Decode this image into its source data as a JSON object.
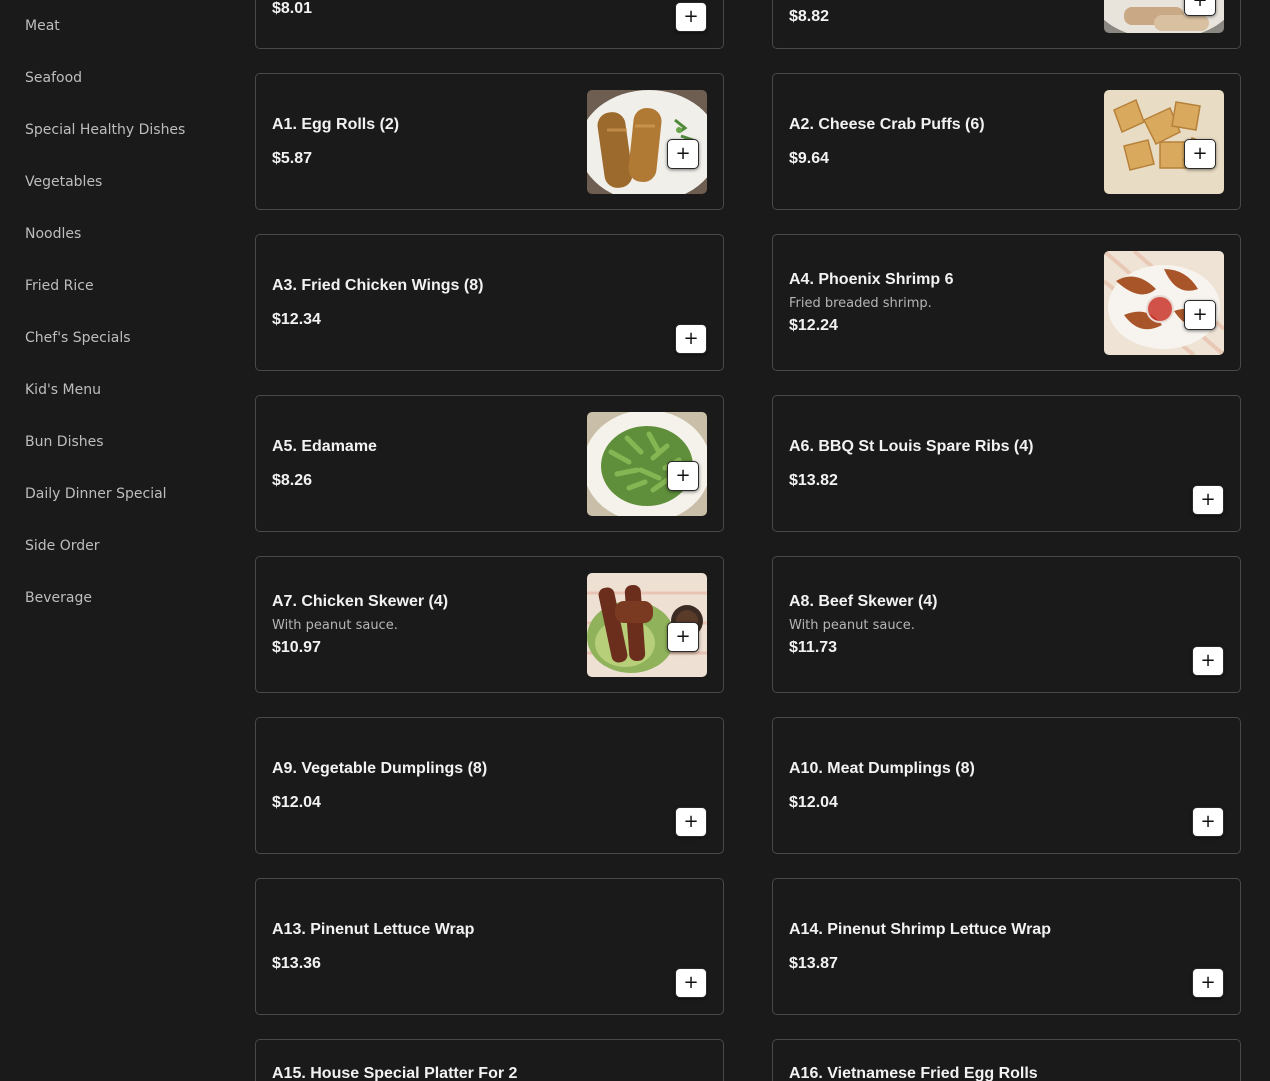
{
  "sidebar": {
    "categories": [
      "Meat",
      "Seafood",
      "Special Healthy Dishes",
      "Vegetables",
      "Noodles",
      "Fried Rice",
      "Chef's Specials",
      "Kid's Menu",
      "Bun Dishes",
      "Daily Dinner Special",
      "Side Order",
      "Beverage"
    ]
  },
  "menu": {
    "items": [
      {
        "name": "",
        "description": "",
        "price": "$8.01",
        "image": "food-photo-generic",
        "add_label": "+"
      },
      {
        "name": "",
        "description": "",
        "price": "$8.82",
        "image": "food-photo-spring-rolls",
        "add_label": "+"
      },
      {
        "name": "A1. Egg Rolls (2)",
        "description": "",
        "price": "$5.87",
        "image": "egg-rolls-photo",
        "add_label": "+"
      },
      {
        "name": "A2. Cheese Crab Puffs (6)",
        "description": "",
        "price": "$9.64",
        "image": "crab-puffs-photo",
        "add_label": "+"
      },
      {
        "name": "A3. Fried Chicken Wings (8)",
        "description": "",
        "price": "$12.34",
        "image": "",
        "add_label": "+"
      },
      {
        "name": "A4. Phoenix Shrimp 6",
        "description": "Fried breaded shrimp.",
        "price": "$12.24",
        "image": "fried-shrimp-photo",
        "add_label": "+"
      },
      {
        "name": "A5. Edamame",
        "description": "",
        "price": "$8.26",
        "image": "edamame-photo",
        "add_label": "+"
      },
      {
        "name": "A6. BBQ St Louis Spare Ribs (4)",
        "description": "",
        "price": "$13.82",
        "image": "",
        "add_label": "+"
      },
      {
        "name": "A7. Chicken Skewer (4)",
        "description": "With peanut sauce.",
        "price": "$10.97",
        "image": "chicken-skewer-photo",
        "add_label": "+"
      },
      {
        "name": "A8. Beef Skewer (4)",
        "description": "With peanut sauce.",
        "price": "$11.73",
        "image": "",
        "add_label": "+"
      },
      {
        "name": "A9. Vegetable Dumplings (8)",
        "description": "",
        "price": "$12.04",
        "image": "",
        "add_label": "+"
      },
      {
        "name": "A10. Meat Dumplings (8)",
        "description": "",
        "price": "$12.04",
        "image": "",
        "add_label": "+"
      },
      {
        "name": "A13. Pinenut Lettuce Wrap",
        "description": "",
        "price": "$13.36",
        "image": "",
        "add_label": "+"
      },
      {
        "name": "A14. Pinenut Shrimp Lettuce Wrap",
        "description": "",
        "price": "$13.87",
        "image": "",
        "add_label": "+"
      },
      {
        "name": "A15. House Special Platter For 2",
        "description": "",
        "price": "",
        "image": "",
        "add_label": "+"
      },
      {
        "name": "A16. Vietnamese Fried Egg Rolls",
        "description": "",
        "price": "",
        "image": "",
        "add_label": "+"
      }
    ]
  },
  "colors": {
    "background": "#1b1a1a",
    "card_border": "#4a4848",
    "text_primary": "#f2f2f2",
    "text_secondary": "#b5b5b5",
    "sidebar_text": "#bdbdbd",
    "button_bg": "#ffffff"
  }
}
